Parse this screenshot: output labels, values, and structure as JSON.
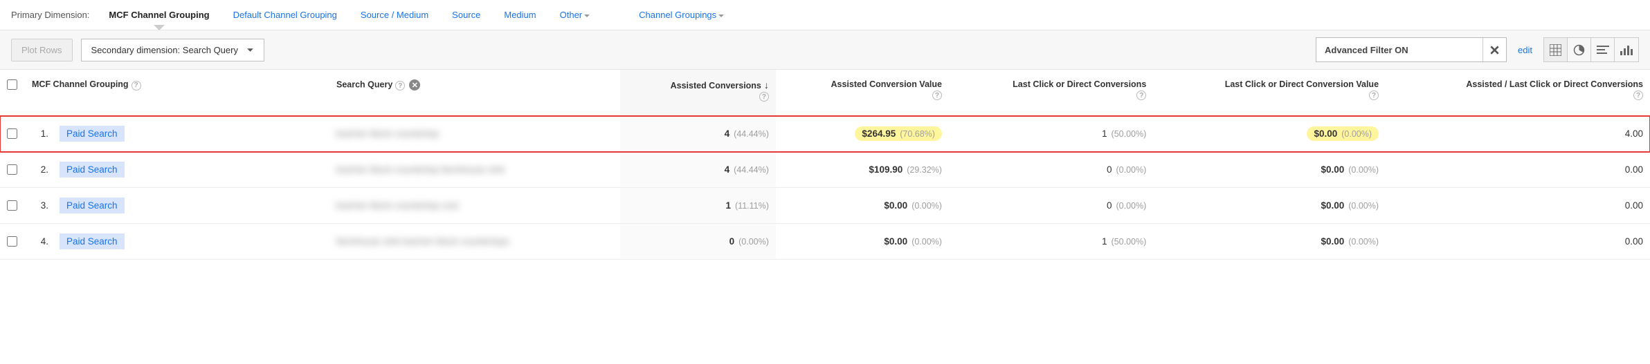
{
  "dimensionBar": {
    "label": "Primary Dimension:",
    "tabs": [
      "MCF Channel Grouping",
      "Default Channel Grouping",
      "Source / Medium",
      "Source",
      "Medium",
      "Other",
      "Channel Groupings"
    ]
  },
  "toolbar": {
    "plot": "Plot Rows",
    "secondary": "Secondary dimension: Search Query",
    "filter": "Advanced Filter ON",
    "edit": "edit"
  },
  "headers": {
    "dim": "MCF Channel Grouping",
    "query": "Search Query",
    "ac": "Assisted Conversions",
    "acv": "Assisted Conversion Value",
    "lcd": "Last Click or Direct Conversions",
    "lcdv": "Last Click or Direct Conversion Value",
    "ratio": "Assisted / Last Click or Direct Conversions"
  },
  "rows": [
    {
      "idx": "1.",
      "channel": "Paid Search",
      "query": "butcher block countertop",
      "ac": "4",
      "ac_pct": "(44.44%)",
      "acv": "$264.95",
      "acv_pct": "(70.68%)",
      "lcd": "1",
      "lcd_pct": "(50.00%)",
      "lcdv": "$0.00",
      "lcdv_pct": "(0.00%)",
      "ratio": "4.00",
      "hl": true
    },
    {
      "idx": "2.",
      "channel": "Paid Search",
      "query": "butcher block countertop farmhouse sink",
      "ac": "4",
      "ac_pct": "(44.44%)",
      "acv": "$109.90",
      "acv_pct": "(29.32%)",
      "lcd": "0",
      "lcd_pct": "(0.00%)",
      "lcdv": "$0.00",
      "lcdv_pct": "(0.00%)",
      "ratio": "0.00",
      "hl": false
    },
    {
      "idx": "3.",
      "channel": "Paid Search",
      "query": "butcher block countertop cost",
      "ac": "1",
      "ac_pct": "(11.11%)",
      "acv": "$0.00",
      "acv_pct": "(0.00%)",
      "lcd": "0",
      "lcd_pct": "(0.00%)",
      "lcdv": "$0.00",
      "lcdv_pct": "(0.00%)",
      "ratio": "0.00",
      "hl": false
    },
    {
      "idx": "4.",
      "channel": "Paid Search",
      "query": "farmhouse sink butcher block countertops",
      "ac": "0",
      "ac_pct": "(0.00%)",
      "acv": "$0.00",
      "acv_pct": "(0.00%)",
      "lcd": "1",
      "lcd_pct": "(50.00%)",
      "lcdv": "$0.00",
      "lcdv_pct": "(0.00%)",
      "ratio": "0.00",
      "hl": false
    }
  ]
}
